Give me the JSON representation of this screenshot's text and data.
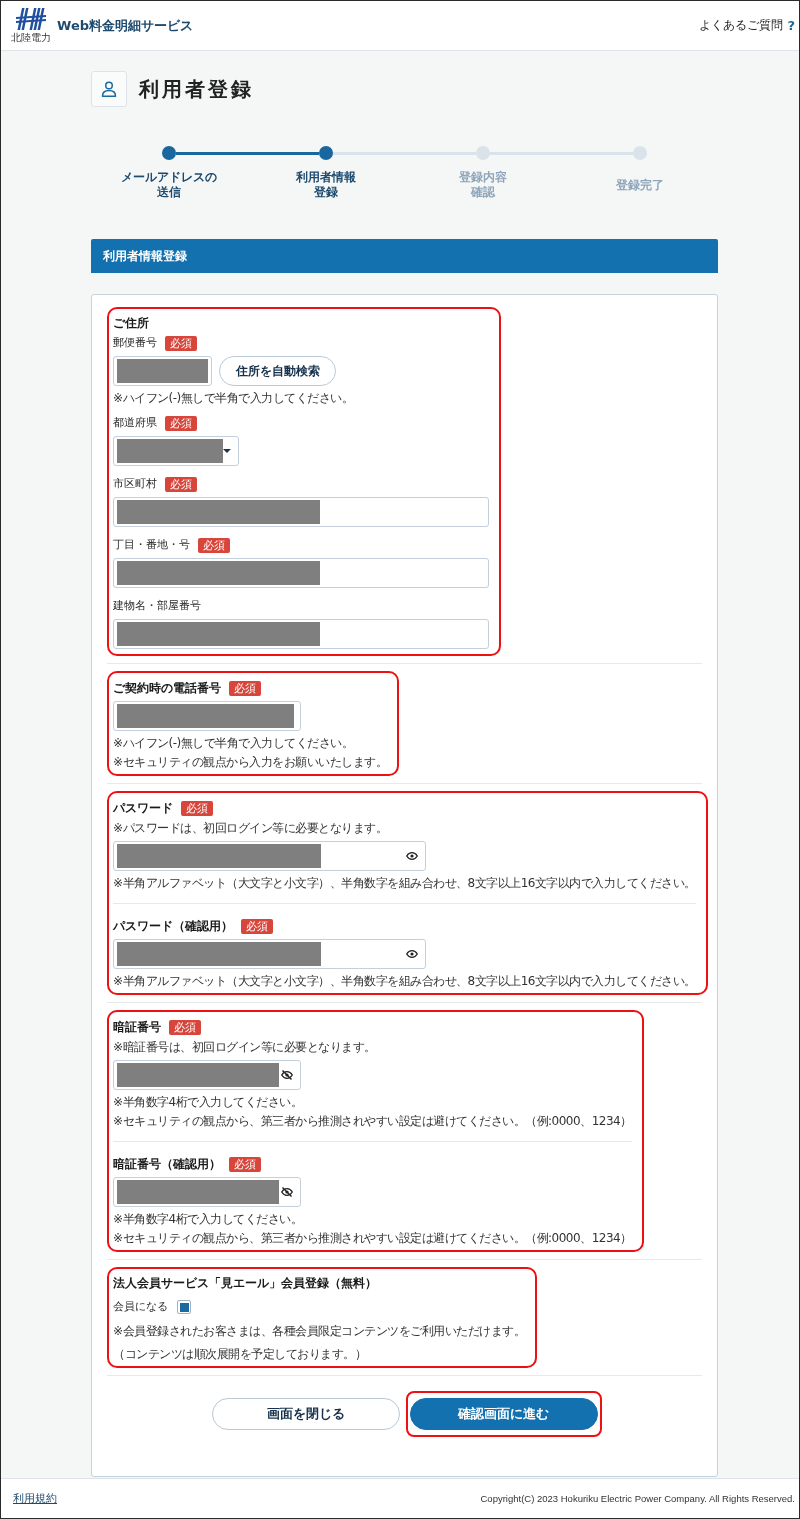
{
  "header": {
    "logo_text": "北陸電力",
    "service_name": "Web料金明細サービス",
    "faq_link": "よくあるご質問",
    "faq_icon": "?"
  },
  "page_title": "利用者登録",
  "steps": [
    {
      "label_lines": [
        "メールアドレスの",
        "送信"
      ],
      "reached": true
    },
    {
      "label_lines": [
        "利用者情報",
        "登録"
      ],
      "reached": true
    },
    {
      "label_lines": [
        "登録内容",
        "確認"
      ],
      "reached": false
    },
    {
      "label_lines": [
        "登録完了"
      ],
      "reached": false
    }
  ],
  "section_bar": "利用者情報登録",
  "form_sections": [
    {
      "highlighted": true,
      "heading": "ご住所",
      "fields": [
        {
          "kind": "postal",
          "label": "郵便番号",
          "badge": "必須",
          "redacted": true,
          "button": "住所を自動検索",
          "notes": [
            "※ハイフン(-)無しで半角で入力してください。"
          ]
        },
        {
          "kind": "select",
          "label": "都道府県",
          "badge": "必須",
          "redacted": true
        },
        {
          "kind": "text",
          "label": "市区町村",
          "badge": "必須",
          "redacted": true
        },
        {
          "kind": "text",
          "label": "丁目・番地・号",
          "badge": "必須",
          "redacted": true
        },
        {
          "kind": "text",
          "label": "建物名・部屋番号",
          "redacted": true
        }
      ]
    },
    {
      "highlighted": true,
      "fields": [
        {
          "kind": "phone",
          "label": "ご契約時の電話番号",
          "badge": "必須",
          "redacted": true,
          "notes": [
            "※ハイフン(-)無しで半角で入力してください。",
            "※セキュリティの観点から入力をお願いいたします。"
          ]
        }
      ]
    },
    {
      "highlighted": true,
      "fields": [
        {
          "kind": "password",
          "label": "パスワード",
          "badge": "必須",
          "hint": "※パスワードは、初回ログイン等に必要となります。",
          "redacted": true,
          "notes": [
            "※半角アルファベット（大文字と小文字）、半角数字を組み合わせ、8文字以上16文字以内で入力してください。"
          ]
        },
        {
          "kind": "password",
          "label": "パスワード（確認用）",
          "badge": "必須",
          "redacted": true,
          "notes": [
            "※半角アルファベット（大文字と小文字）、半角数字を組み合わせ、8文字以上16文字以内で入力してください。"
          ]
        }
      ]
    },
    {
      "highlighted": true,
      "fields": [
        {
          "kind": "pin",
          "label": "暗証番号",
          "badge": "必須",
          "hint": "※暗証番号は、初回ログイン等に必要となります。",
          "redacted": true,
          "notes": [
            "※半角数字4桁で入力してください。",
            "※セキュリティの観点から、第三者から推測されやすい設定は避けてください。（例:0000、1234）"
          ]
        },
        {
          "kind": "pin",
          "label": "暗証番号（確認用）",
          "badge": "必須",
          "redacted": true,
          "notes": [
            "※半角数字4桁で入力してください。",
            "※セキュリティの観点から、第三者から推測されやすい設定は避けてください。（例:0000、1234）"
          ]
        }
      ]
    },
    {
      "highlighted": true,
      "heading": "法人会員サービス「見エール」会員登録（無料）",
      "fields": [
        {
          "kind": "checkbox",
          "label": "会員になる",
          "checked": true,
          "notes": [
            "※会員登録されたお客さまは、各種会員限定コンテンツをご利用いただけます。",
            "（コンテンツは順次展開を予定しております。）"
          ]
        }
      ]
    }
  ],
  "buttons": [
    {
      "kind": "secondary",
      "label": "画面を閉じる",
      "highlighted": false
    },
    {
      "kind": "primary",
      "label": "確認画面に進む",
      "highlighted": true
    }
  ],
  "footer": {
    "terms_link": "利用規約",
    "copyright": "Copyright(C) 2023 Hokuriku Electric Power Company. All Rights Reserved."
  }
}
